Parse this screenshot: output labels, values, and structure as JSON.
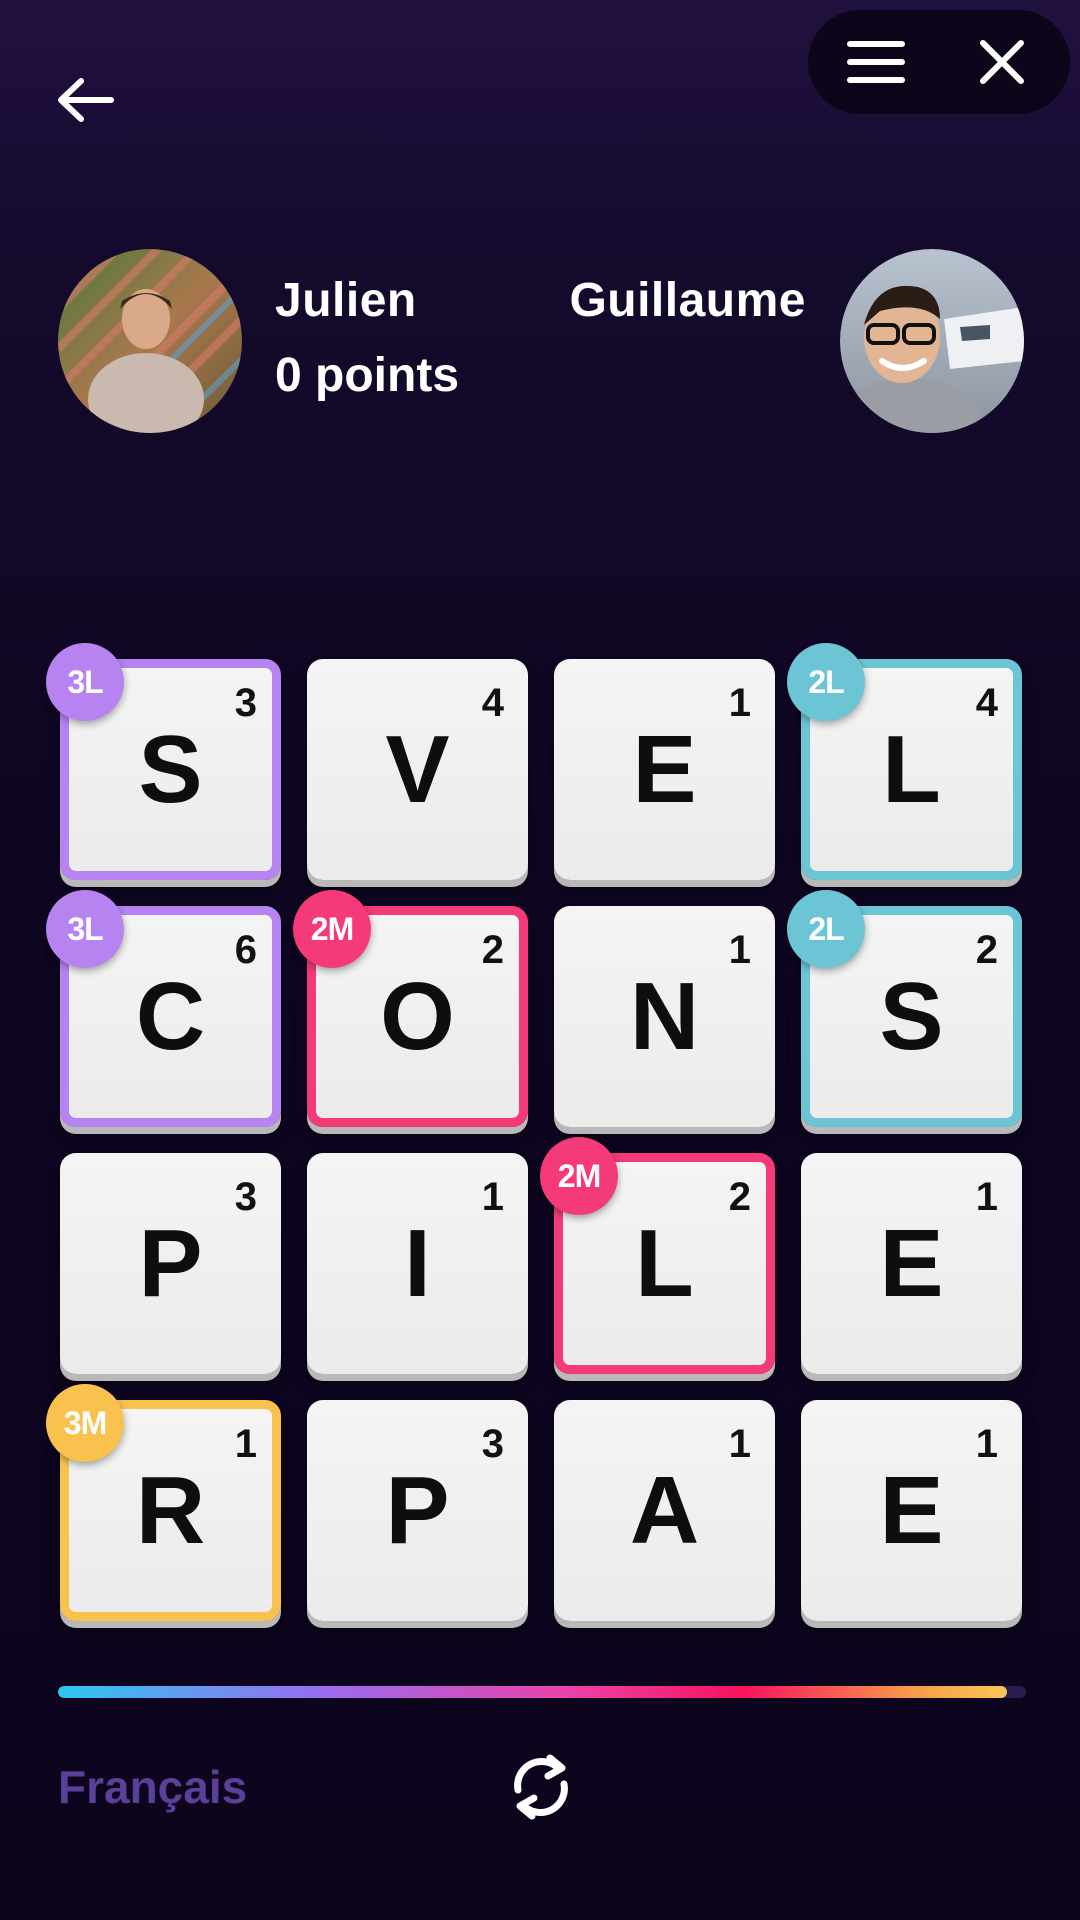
{
  "header": {
    "back_icon": "arrow-left-icon",
    "menu_icon": "hamburger-menu-icon",
    "close_icon": "close-icon"
  },
  "players": [
    {
      "name": "Julien",
      "score_text": "0 points",
      "avatar": "player-photo"
    },
    {
      "name": "Guillaume",
      "avatar": "player-photo"
    }
  ],
  "board": {
    "tiles": [
      {
        "letter": "S",
        "value": "3",
        "bonus": "3L",
        "color": "#b783f1"
      },
      {
        "letter": "V",
        "value": "4",
        "bonus": "",
        "color": ""
      },
      {
        "letter": "E",
        "value": "1",
        "bonus": "",
        "color": ""
      },
      {
        "letter": "L",
        "value": "4",
        "bonus": "2L",
        "color": "#6cc5d5"
      },
      {
        "letter": "C",
        "value": "6",
        "bonus": "3L",
        "color": "#b783f1"
      },
      {
        "letter": "O",
        "value": "2",
        "bonus": "2M",
        "color": "#f43a78"
      },
      {
        "letter": "N",
        "value": "1",
        "bonus": "",
        "color": ""
      },
      {
        "letter": "S",
        "value": "2",
        "bonus": "2L",
        "color": "#6cc5d5"
      },
      {
        "letter": "P",
        "value": "3",
        "bonus": "",
        "color": ""
      },
      {
        "letter": "I",
        "value": "1",
        "bonus": "",
        "color": ""
      },
      {
        "letter": "L",
        "value": "2",
        "bonus": "2M",
        "color": "#f43a78"
      },
      {
        "letter": "E",
        "value": "1",
        "bonus": "",
        "color": ""
      },
      {
        "letter": "R",
        "value": "1",
        "bonus": "3M",
        "color": "#f9c24e"
      },
      {
        "letter": "P",
        "value": "3",
        "bonus": "",
        "color": ""
      },
      {
        "letter": "A",
        "value": "1",
        "bonus": "",
        "color": ""
      },
      {
        "letter": "E",
        "value": "1",
        "bonus": "",
        "color": ""
      }
    ]
  },
  "timer": {
    "remaining_fraction": 0.98
  },
  "footer": {
    "language": "Français",
    "shuffle_icon": "shuffle-icon"
  },
  "colors": {
    "background": "#0f0622",
    "bonus_3L": "#b783f1",
    "bonus_2L": "#6cc5d5",
    "bonus_2M": "#f43a78",
    "bonus_3M": "#f9c24e"
  }
}
